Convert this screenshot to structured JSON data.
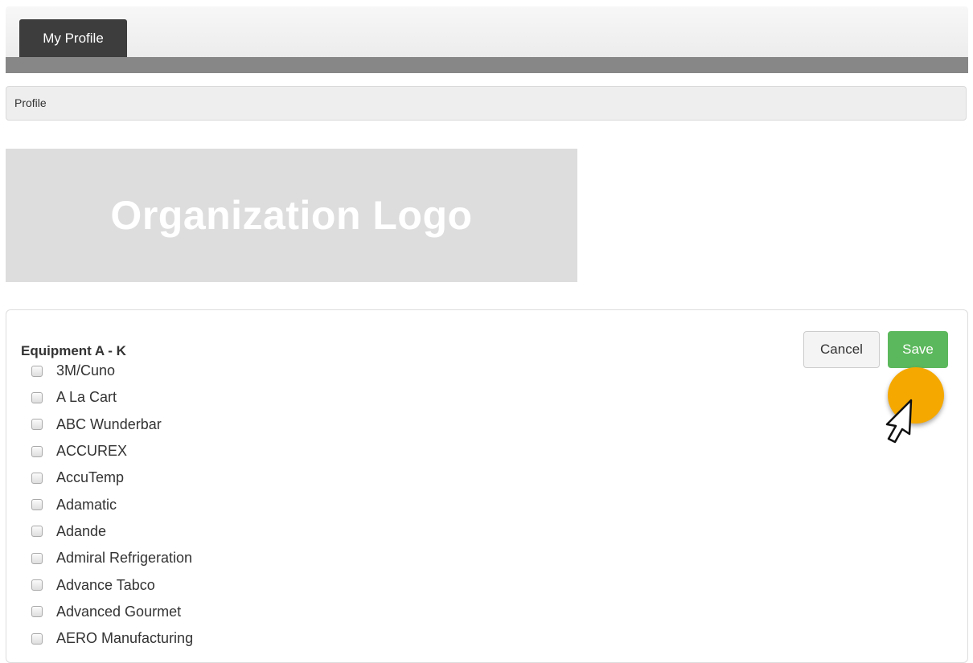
{
  "tabs": [
    {
      "label": "My Profile",
      "active": true
    }
  ],
  "breadcrumb": {
    "label": "Profile"
  },
  "logo": {
    "text": "Organization Logo"
  },
  "panel": {
    "title": "Equipment A - K",
    "cancel_label": "Cancel",
    "save_label": "Save",
    "items": [
      {
        "label": "3M/Cuno",
        "checked": false
      },
      {
        "label": "A La Cart",
        "checked": false
      },
      {
        "label": "ABC Wunderbar",
        "checked": false
      },
      {
        "label": "ACCUREX",
        "checked": false
      },
      {
        "label": "AccuTemp",
        "checked": false
      },
      {
        "label": "Adamatic",
        "checked": false
      },
      {
        "label": "Adande",
        "checked": false
      },
      {
        "label": "Admiral Refrigeration",
        "checked": false
      },
      {
        "label": "Advance Tabco",
        "checked": false
      },
      {
        "label": "Advanced Gourmet",
        "checked": false
      },
      {
        "label": "AERO Manufacturing",
        "checked": false
      }
    ]
  },
  "colors": {
    "tab_bg": "#3d3d3d",
    "strip": "#878787",
    "save_green": "#5cb85c",
    "click_marker": "#f5a800",
    "logo_bg": "#dddddd"
  },
  "icons": {
    "cursor": "arrow-cursor-icon",
    "click_indicator": "click-highlight-circle"
  }
}
